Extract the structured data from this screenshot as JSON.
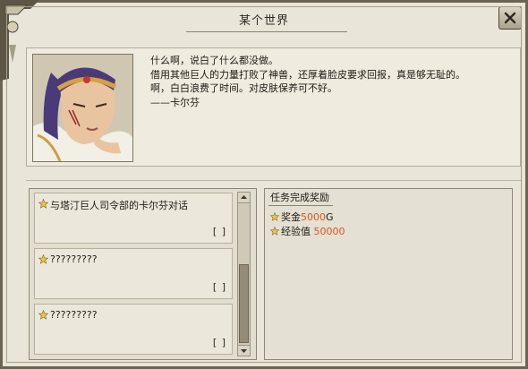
{
  "window": {
    "title": "某个世界"
  },
  "dialog": {
    "lines": [
      "什么啊，说白了什么都没做。",
      "借用其他巨人的力量打败了神兽，还厚着脸皮要求回报，真是够无耻的。",
      "啊，白白浪费了时间。对皮肤保养可不好。",
      "——卡尔芬"
    ]
  },
  "quests": [
    {
      "title": "与塔汀巨人司令部的卡尔芬对话",
      "progress": "[    ]"
    },
    {
      "title": "?????????",
      "progress": "[    ]"
    },
    {
      "title": "?????????",
      "progress": "[    ]"
    }
  ],
  "rewards": {
    "header": "任务完成奖励",
    "items": [
      {
        "label": "奖金",
        "value": "5000",
        "unit": "G"
      },
      {
        "label": "经验值 ",
        "value": "50000",
        "unit": ""
      }
    ]
  },
  "colors": {
    "accent_value": "#d9551c",
    "frame": "#6b6453",
    "panel": "#e9e5d8"
  },
  "icons": {
    "close": "close-icon",
    "quest_bullet": "star-icon",
    "scroll_up": "arrow-up-icon",
    "scroll_down": "arrow-down-icon"
  }
}
